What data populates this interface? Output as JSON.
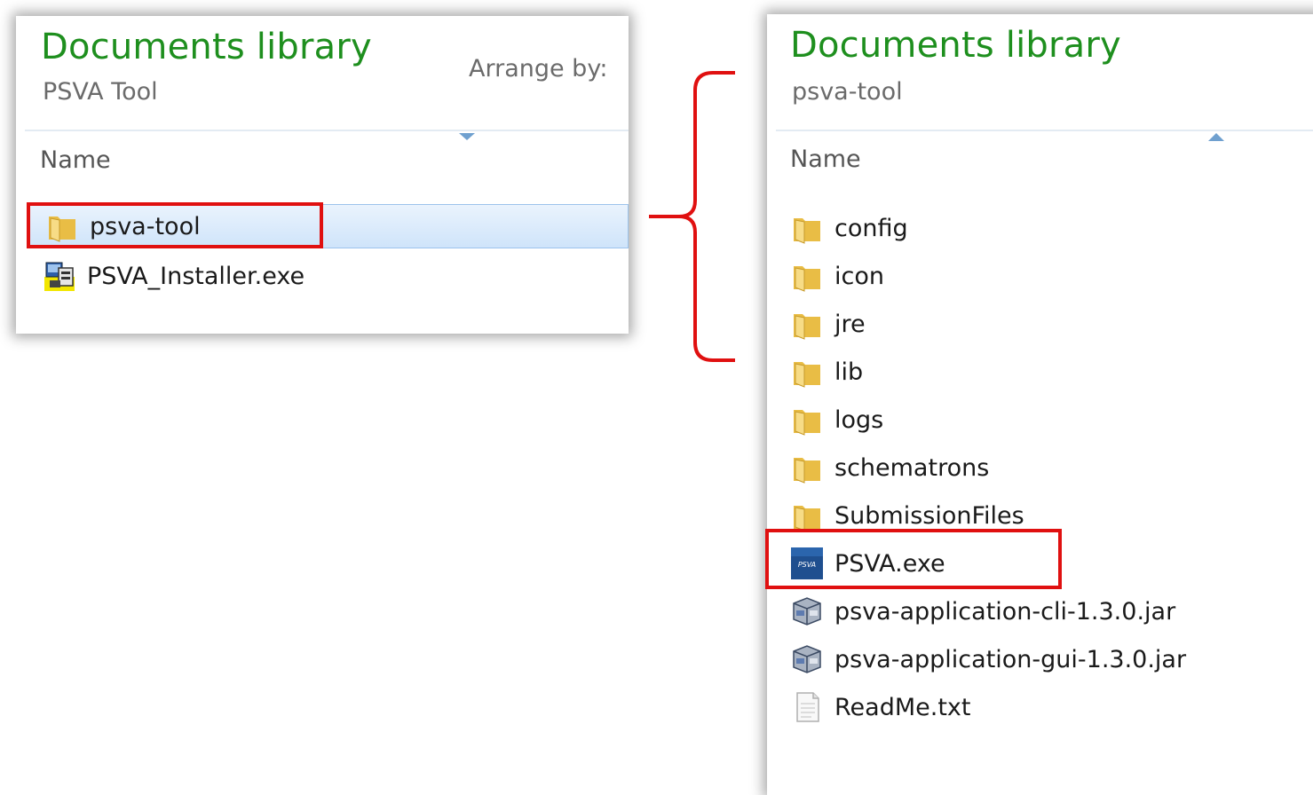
{
  "left_panel": {
    "title": "Documents library",
    "subtitle": "PSVA Tool",
    "arrange_label": "Arrange by:",
    "column_header": "Name",
    "sort_direction": "descending",
    "items": [
      {
        "name": "psva-tool",
        "type": "folder",
        "selected": true,
        "highlighted": true
      },
      {
        "name": "PSVA_Installer.exe",
        "type": "installer-exe",
        "selected": false,
        "highlighted": false
      }
    ]
  },
  "right_panel": {
    "title": "Documents library",
    "subtitle": "psva-tool",
    "column_header": "Name",
    "sort_direction": "ascending",
    "items": [
      {
        "name": "config",
        "type": "folder"
      },
      {
        "name": "icon",
        "type": "folder"
      },
      {
        "name": "jre",
        "type": "folder"
      },
      {
        "name": "lib",
        "type": "folder"
      },
      {
        "name": "logs",
        "type": "folder"
      },
      {
        "name": "schematrons",
        "type": "folder"
      },
      {
        "name": "SubmissionFiles",
        "type": "folder"
      },
      {
        "name": "PSVA.exe",
        "type": "psva-exe",
        "highlighted": true
      },
      {
        "name": "psva-application-cli-1.3.0.jar",
        "type": "jar"
      },
      {
        "name": "psva-application-gui-1.3.0.jar",
        "type": "jar"
      },
      {
        "name": "ReadMe.txt",
        "type": "text-file"
      }
    ]
  },
  "colors": {
    "title_green": "#1e8f1e",
    "highlight_red": "#e01010",
    "selection_blue": "#cfe4fa",
    "folder_yellow": "#f3d36b"
  },
  "icon_glyphs": {
    "psva_exe": "PSVA",
    "installer": "EXE"
  }
}
